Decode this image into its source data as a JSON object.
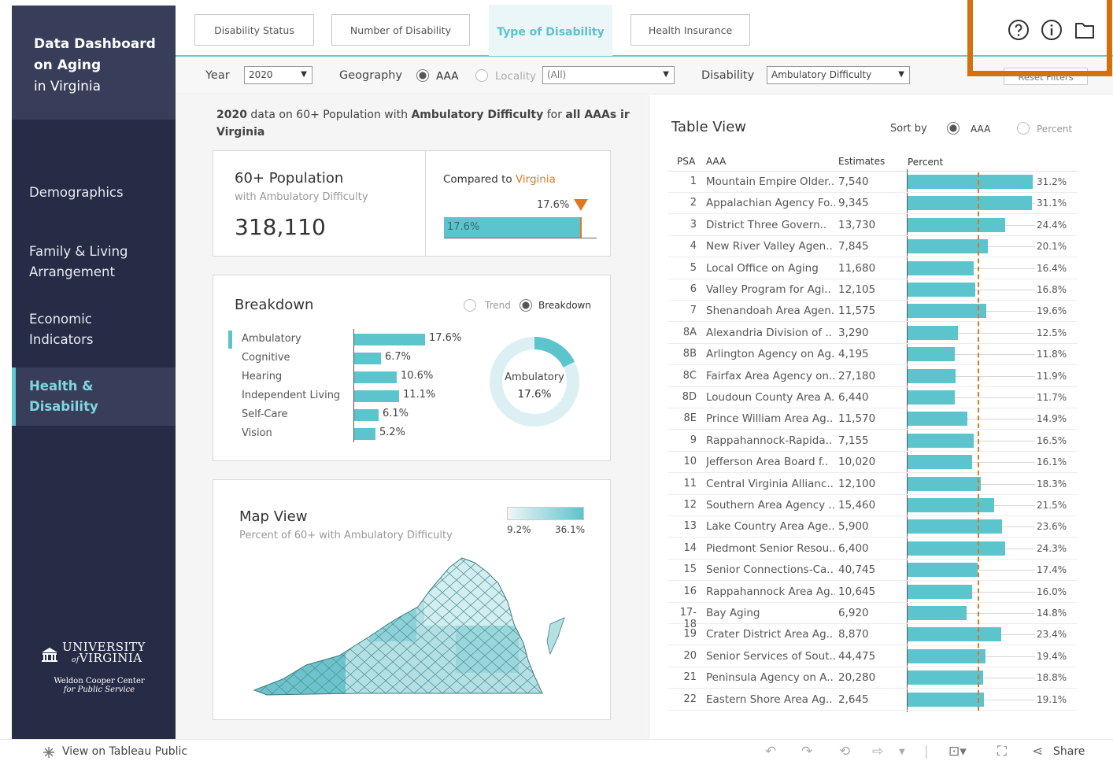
{
  "colors": {
    "accent": "#5bc4cd",
    "orange": "#e0791e",
    "sidebar": "#262c45",
    "highlight": "#d4700e"
  },
  "sidebar": {
    "title_line1": "Data Dashboard",
    "title_line2": "on Aging",
    "title_line3": "in Virginia",
    "items": [
      {
        "line1": "Demographics",
        "line2": ""
      },
      {
        "line1": "Family & Living",
        "line2": "Arrangement"
      },
      {
        "line1": "Economic",
        "line2": "Indicators"
      },
      {
        "line1": "Health &",
        "line2": "Disability"
      }
    ],
    "logo_line1": "UNIVERSITY",
    "logo_line2": "VIRGINIA",
    "logo_of": "of",
    "logo_center_line1": "Weldon Cooper Center",
    "logo_center_line2": "for Public Service"
  },
  "tabs": [
    "Disability Status",
    "Number of Disability",
    "Type of Disability",
    "Health Insurance"
  ],
  "filters": {
    "year_label": "Year",
    "year_value": "2020",
    "geography_label": "Geography",
    "geo_aaa": "AAA",
    "geo_locality": "Locality",
    "locality_value": "(All)",
    "disability_label": "Disability",
    "disability_value": "Ambulatory Difficulty",
    "reset_label": "Reset Filters"
  },
  "subtitle": {
    "year": "2020",
    "t1": " data on 60+ Population with ",
    "dis": "Ambulatory Difficulty",
    "t2": " for ",
    "scope": "all AAAs ir",
    "line2": "Virginia"
  },
  "population": {
    "title": "60+ Population",
    "sub": "with Ambulatory Difficulty",
    "value": "318,110",
    "compared_prefix": "Compared to ",
    "compared_place": "Virginia",
    "bar_label": "17.6%",
    "marker_label": "17.6%"
  },
  "breakdown": {
    "title": "Breakdown",
    "toggle_trend": "Trend",
    "toggle_breakdown": "Breakdown",
    "items": [
      {
        "label": "Ambulatory",
        "value": 17.6,
        "text": "17.6%"
      },
      {
        "label": "Cognitive",
        "value": 6.7,
        "text": "6.7%"
      },
      {
        "label": "Hearing",
        "value": 10.6,
        "text": "10.6%"
      },
      {
        "label": "Independent Living",
        "value": 11.1,
        "text": "11.1%"
      },
      {
        "label": "Self-Care",
        "value": 6.1,
        "text": "6.1%"
      },
      {
        "label": "Vision",
        "value": 5.2,
        "text": "5.2%"
      }
    ],
    "donut_label": "Ambulatory",
    "donut_value_text": "17.6%",
    "donut_value": 17.6
  },
  "map": {
    "title": "Map View",
    "sub": "Percent of 60+ with Ambulatory Difficulty",
    "legend_min": "9.2%",
    "legend_max": "36.1%"
  },
  "table": {
    "title": "Table View",
    "sort_label": "Sort by",
    "sort_aaa": "AAA",
    "sort_percent": "Percent",
    "col_psa": "PSA",
    "col_aaa": "AAA",
    "col_est": "Estimates",
    "col_pct": "Percent",
    "reference_value": 17.6,
    "rows": [
      {
        "psa": "1",
        "aaa": "Mountain Empire Older..",
        "est": "7,540",
        "pct": 31.2,
        "pct_text": "31.2%"
      },
      {
        "psa": "2",
        "aaa": "Appalachian Agency Fo..",
        "est": "9,345",
        "pct": 31.1,
        "pct_text": "31.1%"
      },
      {
        "psa": "3",
        "aaa": "District Three Govern..",
        "est": "13,730",
        "pct": 24.4,
        "pct_text": "24.4%"
      },
      {
        "psa": "4",
        "aaa": "New River Valley Agen..",
        "est": "7,845",
        "pct": 20.1,
        "pct_text": "20.1%"
      },
      {
        "psa": "5",
        "aaa": "Local Office on Aging",
        "est": "11,680",
        "pct": 16.4,
        "pct_text": "16.4%"
      },
      {
        "psa": "6",
        "aaa": "Valley Program for Agi..",
        "est": "12,105",
        "pct": 16.8,
        "pct_text": "16.8%"
      },
      {
        "psa": "7",
        "aaa": "Shenandoah Area Agen..",
        "est": "11,575",
        "pct": 19.6,
        "pct_text": "19.6%"
      },
      {
        "psa": "8A",
        "aaa": "Alexandria Division of ..",
        "est": "3,290",
        "pct": 12.5,
        "pct_text": "12.5%"
      },
      {
        "psa": "8B",
        "aaa": "Arlington Agency on Ag..",
        "est": "4,195",
        "pct": 11.8,
        "pct_text": "11.8%"
      },
      {
        "psa": "8C",
        "aaa": "Fairfax Area Agency on..",
        "est": "27,180",
        "pct": 11.9,
        "pct_text": "11.9%"
      },
      {
        "psa": "8D",
        "aaa": "Loudoun County Area A..",
        "est": "6,440",
        "pct": 11.7,
        "pct_text": "11.7%"
      },
      {
        "psa": "8E",
        "aaa": "Prince William Area Ag..",
        "est": "11,570",
        "pct": 14.9,
        "pct_text": "14.9%"
      },
      {
        "psa": "9",
        "aaa": "Rappahannock-Rapida..",
        "est": "7,155",
        "pct": 16.5,
        "pct_text": "16.5%"
      },
      {
        "psa": "10",
        "aaa": "Jefferson Area Board f..",
        "est": "10,020",
        "pct": 16.1,
        "pct_text": "16.1%"
      },
      {
        "psa": "11",
        "aaa": "Central Virginia Allianc..",
        "est": "12,100",
        "pct": 18.3,
        "pct_text": "18.3%"
      },
      {
        "psa": "12",
        "aaa": "Southern Area Agency ..",
        "est": "15,460",
        "pct": 21.5,
        "pct_text": "21.5%"
      },
      {
        "psa": "13",
        "aaa": "Lake Country Area Age..",
        "est": "5,900",
        "pct": 23.6,
        "pct_text": "23.6%"
      },
      {
        "psa": "14",
        "aaa": "Piedmont Senior Resou..",
        "est": "6,400",
        "pct": 24.3,
        "pct_text": "24.3%"
      },
      {
        "psa": "15",
        "aaa": "Senior Connections-Ca..",
        "est": "40,745",
        "pct": 17.4,
        "pct_text": "17.4%"
      },
      {
        "psa": "16",
        "aaa": "Rappahannock Area Ag..",
        "est": "10,645",
        "pct": 16.0,
        "pct_text": "16.0%"
      },
      {
        "psa": "17-18",
        "aaa": "Bay Aging",
        "est": "6,920",
        "pct": 14.8,
        "pct_text": "14.8%"
      },
      {
        "psa": "19",
        "aaa": "Crater District Area Ag..",
        "est": "8,870",
        "pct": 23.4,
        "pct_text": "23.4%"
      },
      {
        "psa": "20",
        "aaa": "Senior Services of Sout..",
        "est": "44,475",
        "pct": 19.4,
        "pct_text": "19.4%"
      },
      {
        "psa": "21",
        "aaa": "Peninsula Agency on A..",
        "est": "20,280",
        "pct": 18.8,
        "pct_text": "18.8%"
      },
      {
        "psa": "22",
        "aaa": "Eastern Shore Area Ag..",
        "est": "2,645",
        "pct": 19.1,
        "pct_text": "19.1%"
      }
    ]
  },
  "footer": {
    "view_label": "View on Tableau Public",
    "share_label": "Share"
  }
}
